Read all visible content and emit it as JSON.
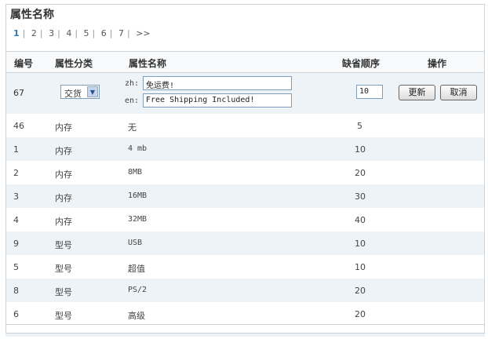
{
  "title": "属性名称",
  "pagination": {
    "current": "1",
    "pages": [
      "2",
      "3",
      "4",
      "5",
      "6",
      "7"
    ],
    "next": ">>"
  },
  "columns": [
    "编号",
    "属性分类",
    "属性名称",
    "缺省顺序",
    "操作"
  ],
  "edit_row": {
    "id": "67",
    "category": "交货",
    "zh_label": "zh:",
    "zh_value": "免运费!",
    "en_label": "en:",
    "en_value": "Free Shipping Included!",
    "order": "10",
    "update_label": "更新",
    "cancel_label": "取消"
  },
  "rows": [
    {
      "id": "46",
      "category": "内存",
      "name": "无",
      "order": "5"
    },
    {
      "id": "1",
      "category": "内存",
      "name": "4 mb",
      "order": "10"
    },
    {
      "id": "2",
      "category": "内存",
      "name": "8MB",
      "order": "20"
    },
    {
      "id": "3",
      "category": "内存",
      "name": "16MB",
      "order": "30"
    },
    {
      "id": "4",
      "category": "内存",
      "name": "32MB",
      "order": "40"
    },
    {
      "id": "9",
      "category": "型号",
      "name": "USB",
      "order": "10"
    },
    {
      "id": "5",
      "category": "型号",
      "name": "超值",
      "order": "10"
    },
    {
      "id": "8",
      "category": "型号",
      "name": "PS/2",
      "order": "20"
    },
    {
      "id": "6",
      "category": "型号",
      "name": "高级",
      "order": "20"
    }
  ]
}
